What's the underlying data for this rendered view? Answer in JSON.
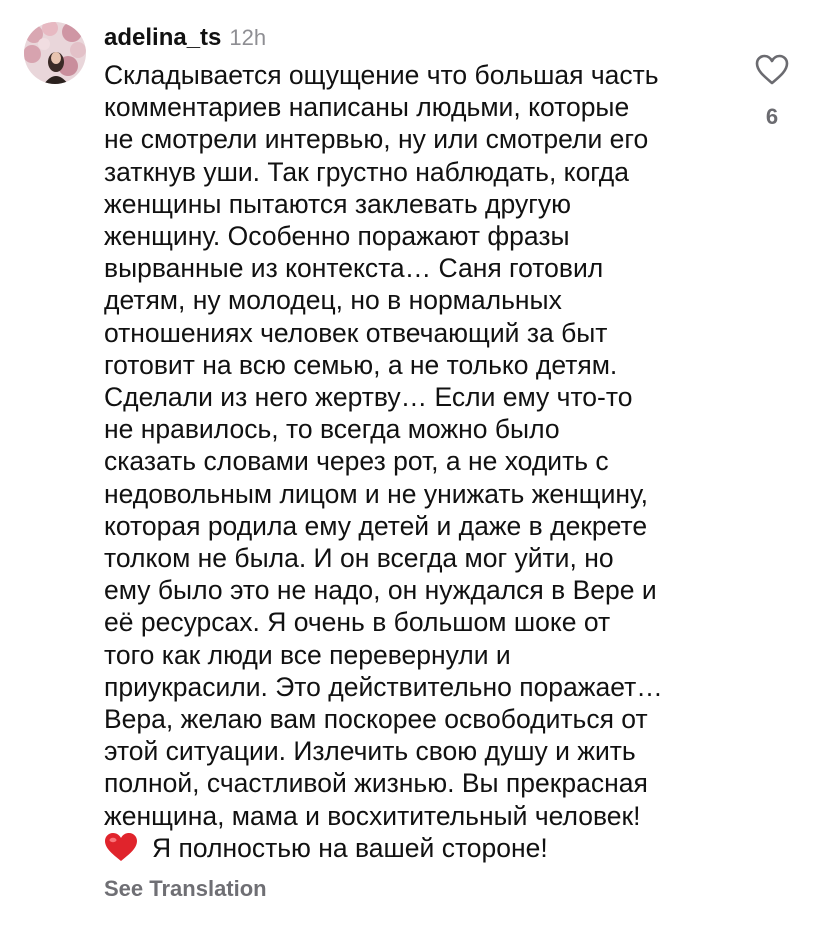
{
  "comment": {
    "username": "adelina_ts",
    "timestamp": "12h",
    "text_lines": [
      "Складывается ощущение что большая часть",
      "комментариев написаны людьми, которые",
      "не смотрели интервью, ну или смотрели его",
      "заткнув уши. Так грустно наблюдать, когда",
      "женщины пытаются заклевать другую",
      "женщину. Особенно поражают фразы",
      "вырванные из контекста… Саня готовил",
      "детям, ну молодец, но в нормальных",
      "отношениях человек отвечающий за быт",
      "готовит на всю семью, а не только детям.",
      "Сделали из него жертву… Если ему что-то",
      "не нравилось, то всегда можно было",
      "сказать словами через рот, а не ходить с",
      "недовольным лицом и не унижать женщину,",
      "которая родила ему детей и даже в декрете",
      "толком не была. И он всегда мог уйти, но",
      "ему было это не надо, он нуждался в Вере и",
      "её ресурсах. Я очень в большом шоке от",
      "того как люди все перевернули и",
      "приукрасили. Это действительно поражает…",
      "Вера, желаю вам поскорее освободиться от",
      "этой ситуации. Излечить свою душу и жить",
      "полной, счастливой жизнью. Вы прекрасная",
      "женщина, мама и восхитительный человек!"
    ],
    "last_line_text": "Я полностью на вашей стороне!",
    "emoji_icon": "red-heart-emoji",
    "like_icon": "heart-outline-icon",
    "like_count": "6",
    "see_translation_label": "See Translation"
  },
  "colors": {
    "text": "#111111",
    "secondary_text": "#8e8e93",
    "like_count": "#6b6b70",
    "heart_emoji": "#e0242c"
  }
}
